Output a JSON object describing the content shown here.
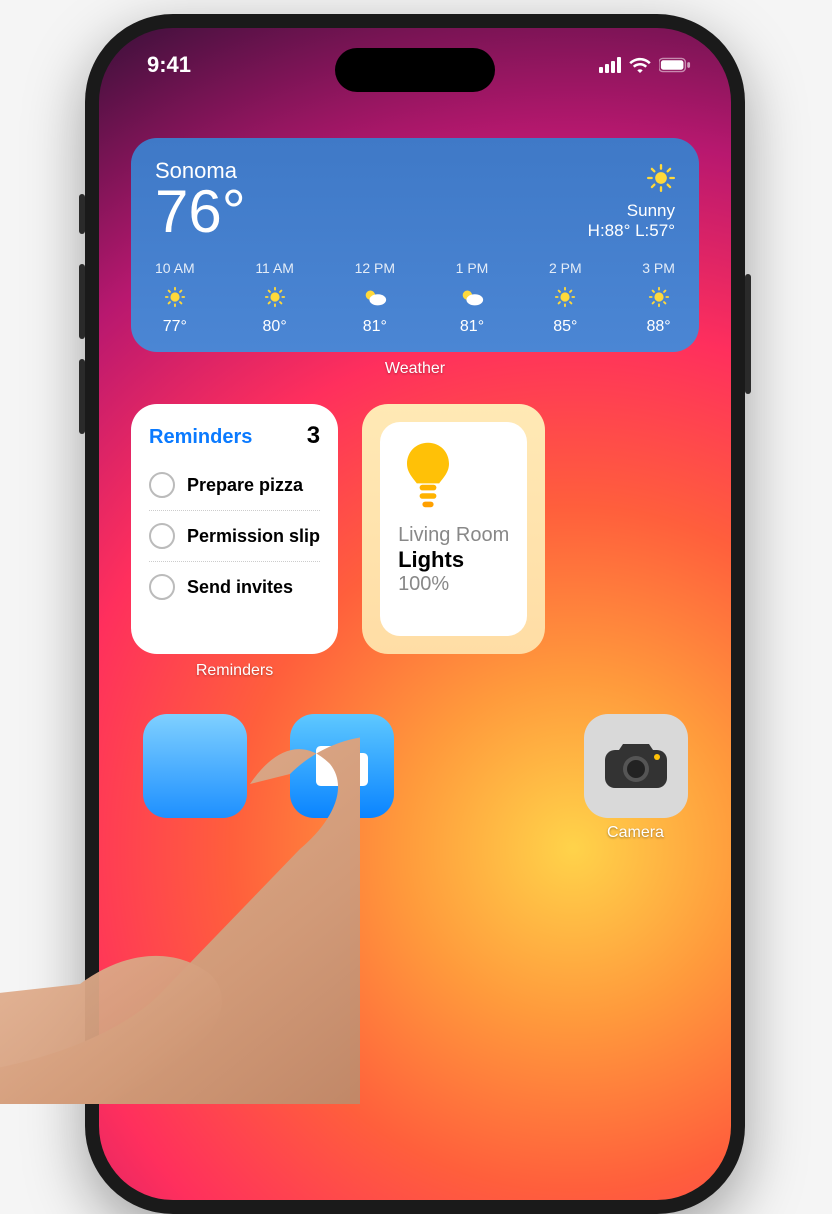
{
  "status_bar": {
    "time": "9:41"
  },
  "weather": {
    "location": "Sonoma",
    "temp": "76°",
    "condition": "Sunny",
    "hi_lo": "H:88° L:57°",
    "label": "Weather",
    "hourly": [
      {
        "time": "10 AM",
        "icon": "sun",
        "temp": "77°"
      },
      {
        "time": "11 AM",
        "icon": "sun",
        "temp": "80°"
      },
      {
        "time": "12 PM",
        "icon": "partly",
        "temp": "81°"
      },
      {
        "time": "1 PM",
        "icon": "partly",
        "temp": "81°"
      },
      {
        "time": "2 PM",
        "icon": "sun",
        "temp": "85°"
      },
      {
        "time": "3 PM",
        "icon": "sun",
        "temp": "88°"
      }
    ]
  },
  "reminders": {
    "title": "Reminders",
    "count": "3",
    "label": "Reminders",
    "items": [
      {
        "text": "Prepare pizza"
      },
      {
        "text": "Permission slip"
      },
      {
        "text": "Send invites"
      }
    ]
  },
  "home": {
    "room": "Living Room",
    "device": "Lights",
    "level": "100%"
  },
  "apps": {
    "camera_label": "Camera"
  }
}
